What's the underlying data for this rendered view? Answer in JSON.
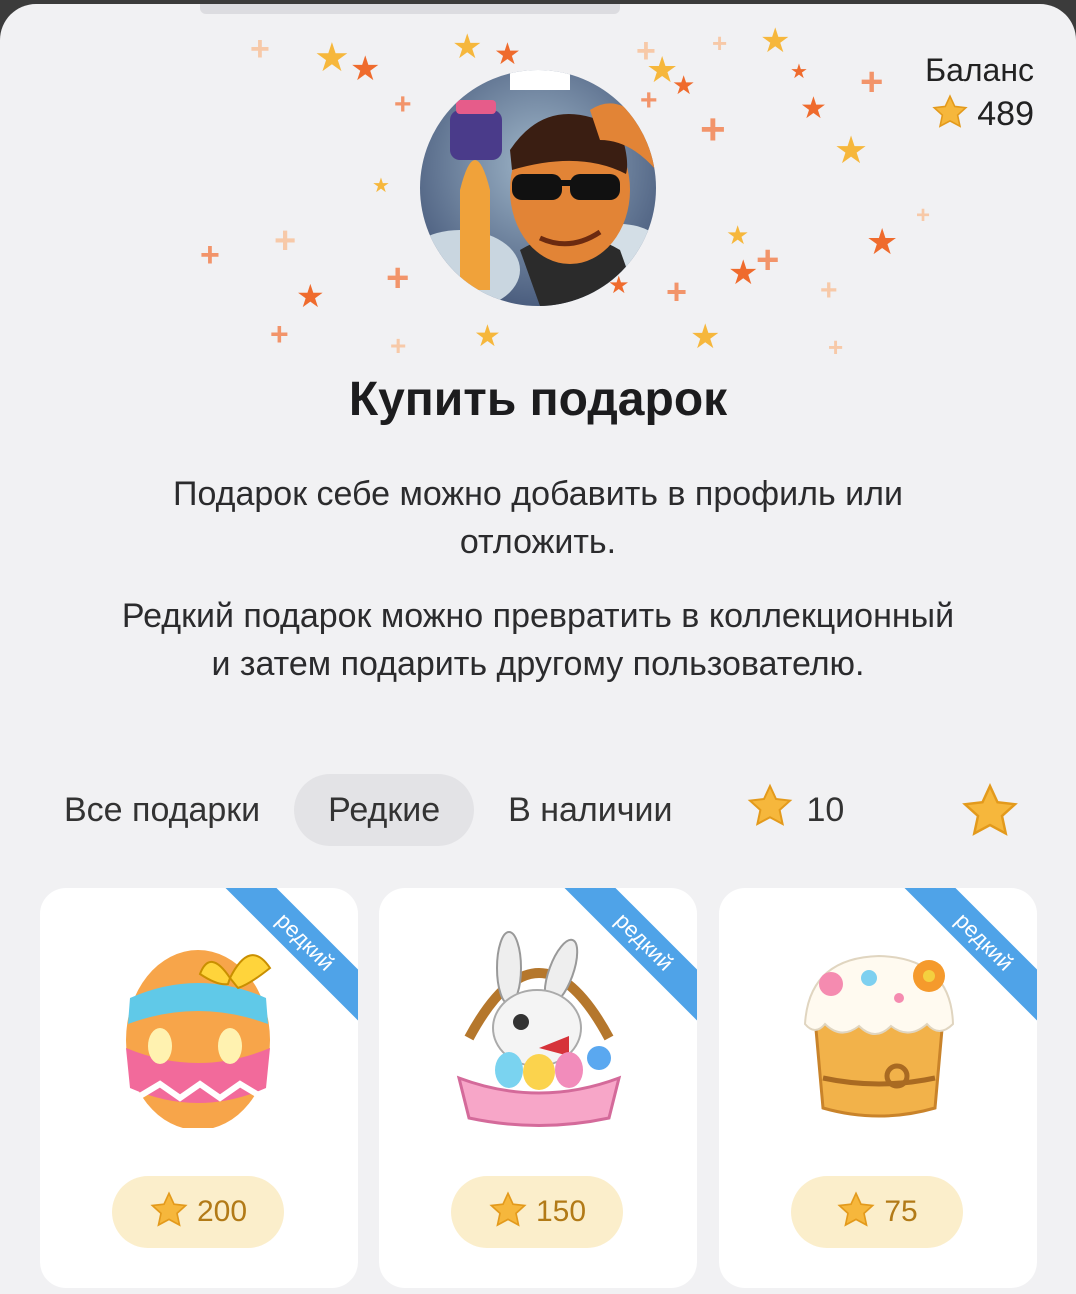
{
  "balance": {
    "label": "Баланс",
    "value": "489"
  },
  "header": {
    "avatar_icon": "profile-avatar-icon"
  },
  "title": "Купить подарок",
  "descriptions": [
    "Подарок себе можно добавить в профиль или отложить.",
    "Редкий подарок можно превратить в коллекционный и затем подарить другому пользователю."
  ],
  "tabs": [
    {
      "label": "Все подарки",
      "active": false
    },
    {
      "label": "Редкие",
      "active": true
    },
    {
      "label": "В наличии",
      "active": false
    },
    {
      "label": "10",
      "active": false
    }
  ],
  "gifts": [
    {
      "badge": "редкий",
      "price": "200",
      "icon": "easter-egg-icon"
    },
    {
      "badge": "редкий",
      "price": "150",
      "icon": "bunny-basket-icon"
    },
    {
      "badge": "редкий",
      "price": "75",
      "icon": "easter-cake-icon"
    }
  ],
  "colors": {
    "ribbon": "#4fa3e8",
    "star": "#f6b73c",
    "price_pill": "#fbeecb"
  }
}
